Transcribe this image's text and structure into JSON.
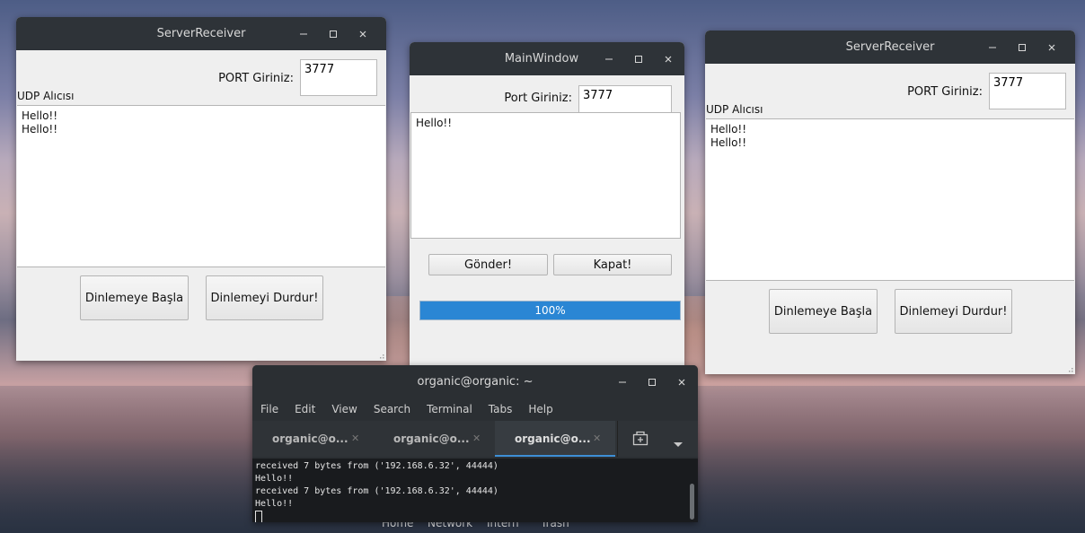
{
  "left_window": {
    "title": "ServerReceiver",
    "port_label": "PORT Giriniz:",
    "port_value": "3777",
    "udp_label": "UDP Alıcısı",
    "messages": [
      "Hello!!",
      "Hello!!"
    ],
    "start_button": "Dinlemeye Başla",
    "stop_button": "Dinlemeyi Durdur!"
  },
  "main_window": {
    "title": "MainWindow",
    "port_label": "Port Giriniz:",
    "port_value": "3777",
    "message_text": "Hello!!",
    "send_button": "Gönder!",
    "close_button": "Kapat!",
    "progress_percent": 100,
    "progress_text": "100%",
    "progress_color": "#2a86d4"
  },
  "right_window": {
    "title": "ServerReceiver",
    "port_label": "PORT Giriniz:",
    "port_value": "3777",
    "udp_label": "UDP Alıcısı",
    "messages": [
      "Hello!!",
      "Hello!!"
    ],
    "start_button": "Dinlemeye Başla",
    "stop_button": "Dinlemeyi Durdur!"
  },
  "terminal": {
    "title": "organic@organic: ~",
    "menu": [
      "File",
      "Edit",
      "View",
      "Search",
      "Terminal",
      "Tabs",
      "Help"
    ],
    "tabs": [
      {
        "label": "organic@o...",
        "active": false
      },
      {
        "label": "organic@o...",
        "active": false
      },
      {
        "label": "organic@o...",
        "active": true
      }
    ],
    "lines": [
      "received 7 bytes from ('192.168.6.32', 44444)",
      "Hello!!",
      "received 7 bytes from ('192.168.6.32', 44444)",
      "Hello!!"
    ]
  },
  "dock": {
    "labels": [
      "Home",
      "Network",
      "Intern",
      "Trash"
    ]
  },
  "icons": {
    "minimize": "minimize-icon",
    "maximize": "maximize-icon",
    "close": "close-icon",
    "new_tab": "new-tab-icon",
    "tab_menu": "chevron-down-icon"
  }
}
